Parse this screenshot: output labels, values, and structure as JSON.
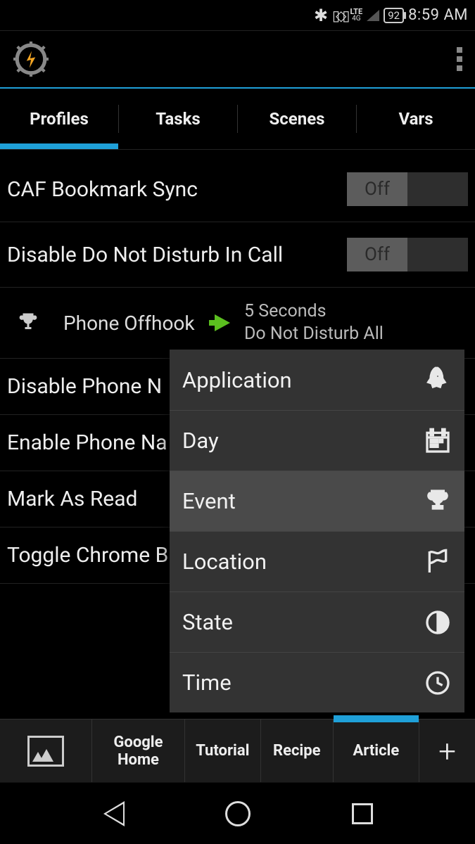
{
  "status": {
    "battery": "92",
    "time": "8:59 AM",
    "lte_top": "LTE",
    "lte_bot": "4G"
  },
  "tabs": [
    "Profiles",
    "Tasks",
    "Scenes",
    "Vars"
  ],
  "toggle_off": "Off",
  "profiles": [
    {
      "name": "CAF Bookmark Sync",
      "toggle": true
    },
    {
      "name": "Disable Do Not Disturb In Call",
      "toggle": true
    }
  ],
  "detail": {
    "label": "Phone Offhook",
    "line1": "5 Seconds",
    "line2": "Do Not Disturb All"
  },
  "profiles_more": [
    "Disable Phone N",
    "Enable Phone Na",
    "Mark As Read",
    "Toggle Chrome B"
  ],
  "popup": [
    {
      "label": "Application",
      "icon": "rocket"
    },
    {
      "label": "Day",
      "icon": "calendar"
    },
    {
      "label": "Event",
      "icon": "trophy"
    },
    {
      "label": "Location",
      "icon": "flag"
    },
    {
      "label": "State",
      "icon": "contrast"
    },
    {
      "label": "Time",
      "icon": "clock"
    }
  ],
  "popup_highlight": "Event",
  "bottom": {
    "items": [
      "Google Home",
      "Tutorial",
      "Recipe",
      "Article"
    ]
  }
}
